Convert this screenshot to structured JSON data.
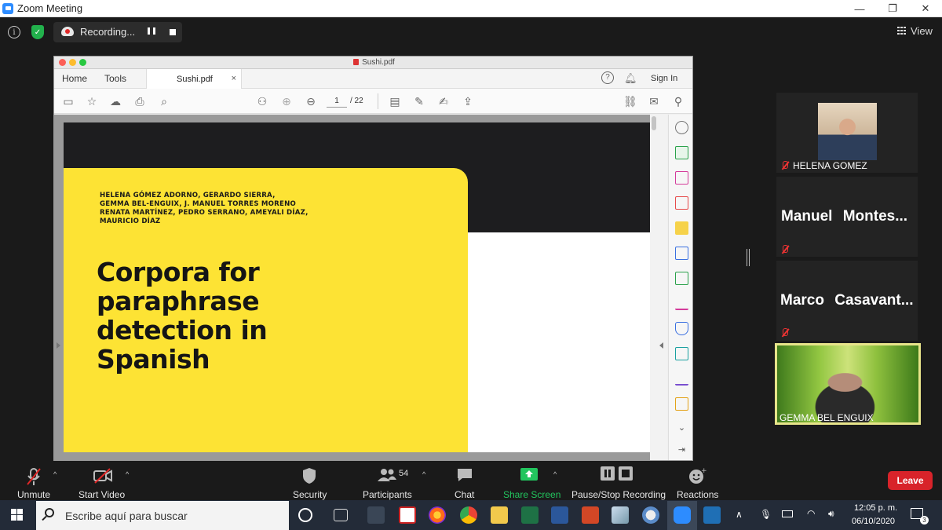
{
  "window": {
    "title": "Zoom Meeting",
    "controls": [
      "—",
      "❐",
      "✕"
    ]
  },
  "zoom_top": {
    "recording_label": "Recording...",
    "view_label": "View"
  },
  "acrobat": {
    "file_title": "Sushi.pdf",
    "menu": {
      "home": "Home",
      "tools": "Tools",
      "tab_label": "Sushi.pdf",
      "tab_close": "×",
      "sign_in": "Sign In"
    },
    "toolbar": {
      "page_current": "1",
      "page_total": "/ 22"
    }
  },
  "document": {
    "authors": [
      "HELENA GÓMEZ ADORNO, GERARDO SIERRA,",
      "GEMMA BEL-ENGUIX, J. MANUEL TORRES MORENO",
      "RENATA MARTÍNEZ, PEDRO SERRANO, AMEYALI DÍAZ,",
      "MAURICIO DÍAZ"
    ],
    "title_lines": [
      "Corpora for",
      "paraphrase",
      "detection in",
      "Spanish"
    ]
  },
  "participants": [
    {
      "name": "HELENA GOMEZ"
    },
    {
      "name": "Manuel  Montes..."
    },
    {
      "name": "Marco  Casavant..."
    },
    {
      "name": "GEMMA BEL ENGUIX"
    }
  ],
  "bottom_toolbar": {
    "unmute": "Unmute",
    "start_video": "Start Video",
    "security": "Security",
    "participants": "Participants",
    "participants_count": "54",
    "chat": "Chat",
    "share_screen": "Share Screen",
    "pause_stop": "Pause/Stop Recording",
    "reactions": "Reactions",
    "leave": "Leave"
  },
  "taskbar": {
    "search_placeholder": "Escribe aquí para buscar",
    "time": "12:05 p. m.",
    "date": "06/10/2020",
    "notifications": "3"
  },
  "colors": {
    "zoom_blue": "#2d8cff",
    "doc_yellow": "#fde334",
    "leave_red": "#d8232a",
    "share_green": "#22c55e"
  }
}
